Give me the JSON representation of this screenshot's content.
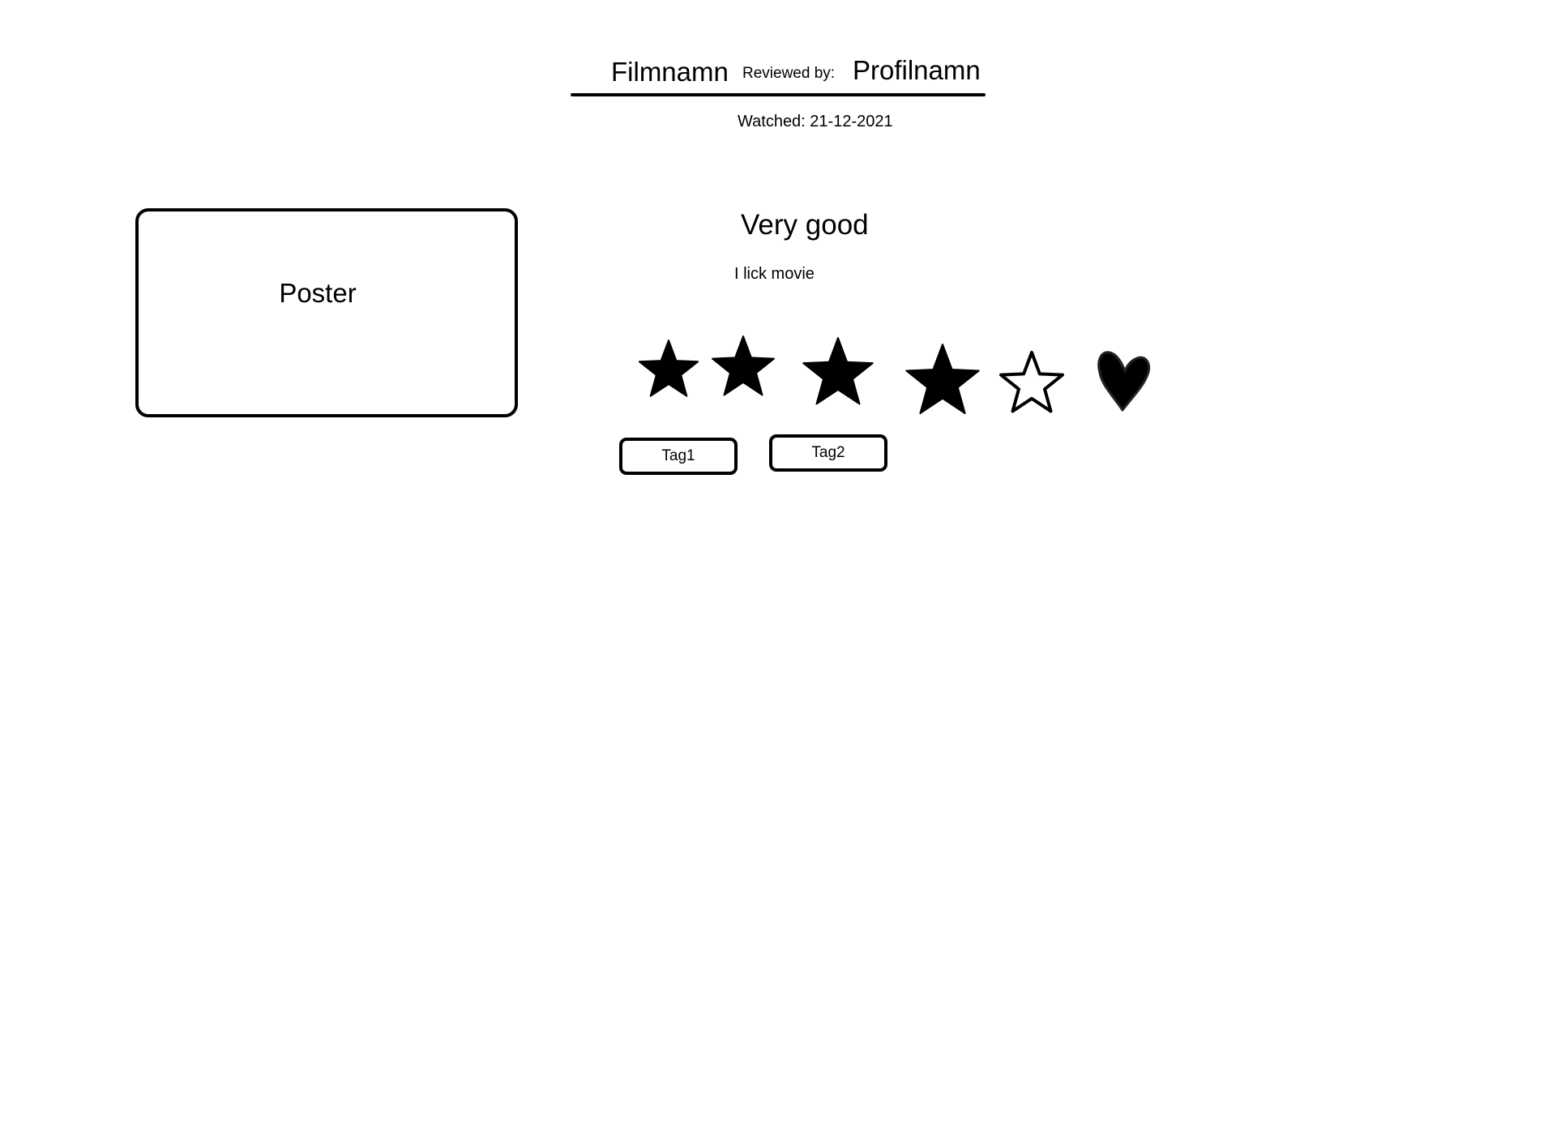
{
  "header": {
    "film_title": "Filmnamn",
    "reviewed_by_label": "Reviewed by:",
    "profile_name": "Profilnamn",
    "watched": "Watched: 21-12-2021"
  },
  "poster": {
    "label": "Poster"
  },
  "review": {
    "headline": "Very good",
    "body": "I lick movie"
  },
  "rating": {
    "filled_stars": 4,
    "max_stars": 5,
    "liked": true
  },
  "tags": [
    "Tag1",
    "Tag2"
  ],
  "icons": {
    "star": "star-icon",
    "heart": "heart-icon"
  },
  "colors": {
    "ink": "#000000",
    "background": "#ffffff"
  }
}
